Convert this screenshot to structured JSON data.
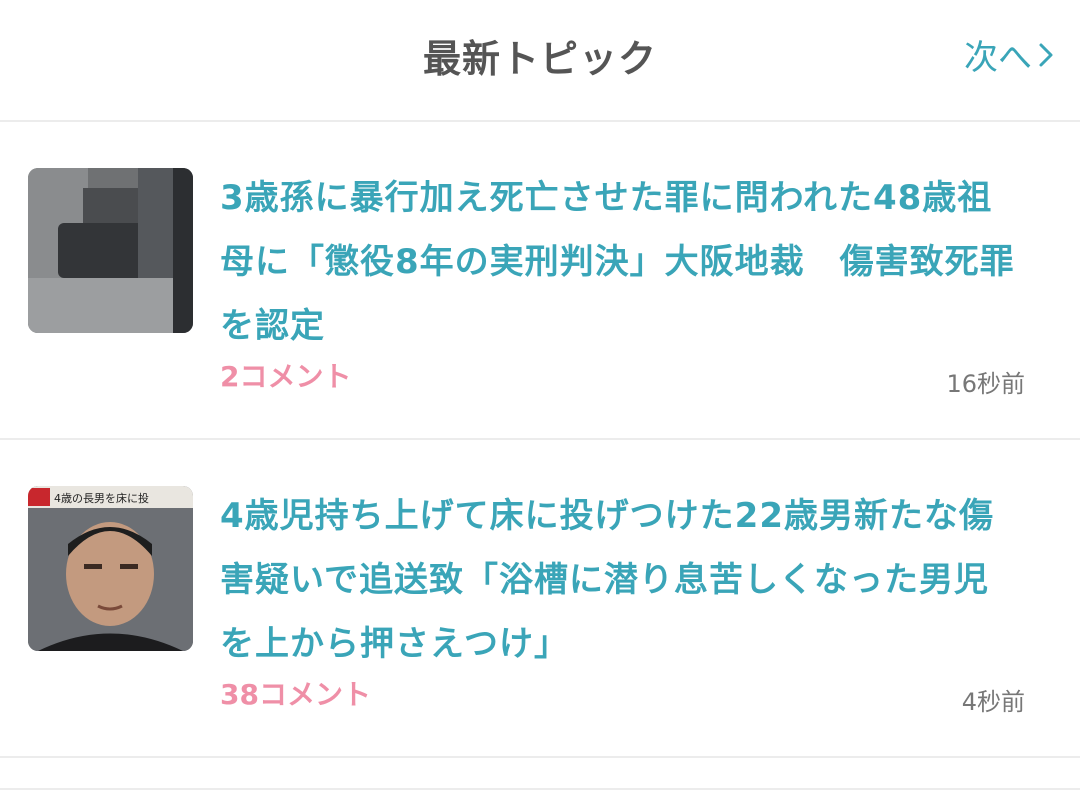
{
  "header": {
    "title": "最新トピック",
    "next_label": "次へ"
  },
  "topics": [
    {
      "title": "3歳孫に暴行加え死亡させた罪に問われた48歳祖母に「懲役8年の実刑判決」大阪地裁　傷害致死罪を認定",
      "comments": "2コメント",
      "time": "16秒前",
      "thumb_icon": "courtroom-photo"
    },
    {
      "title": "4歳児持ち上げて床に投げつけた22歳男新たな傷害疑いで追送致「浴槽に潜り息苦しくなった男児を上から押さえつけ」",
      "comments": "38コメント",
      "time": "4秒前",
      "thumb_icon": "suspect-photo",
      "thumb_caption": "4歳の長男を床に投"
    }
  ],
  "colors": {
    "title": "#3aa5b8",
    "comments": "#ef8fa7",
    "header": "#555555",
    "time": "#777777"
  }
}
